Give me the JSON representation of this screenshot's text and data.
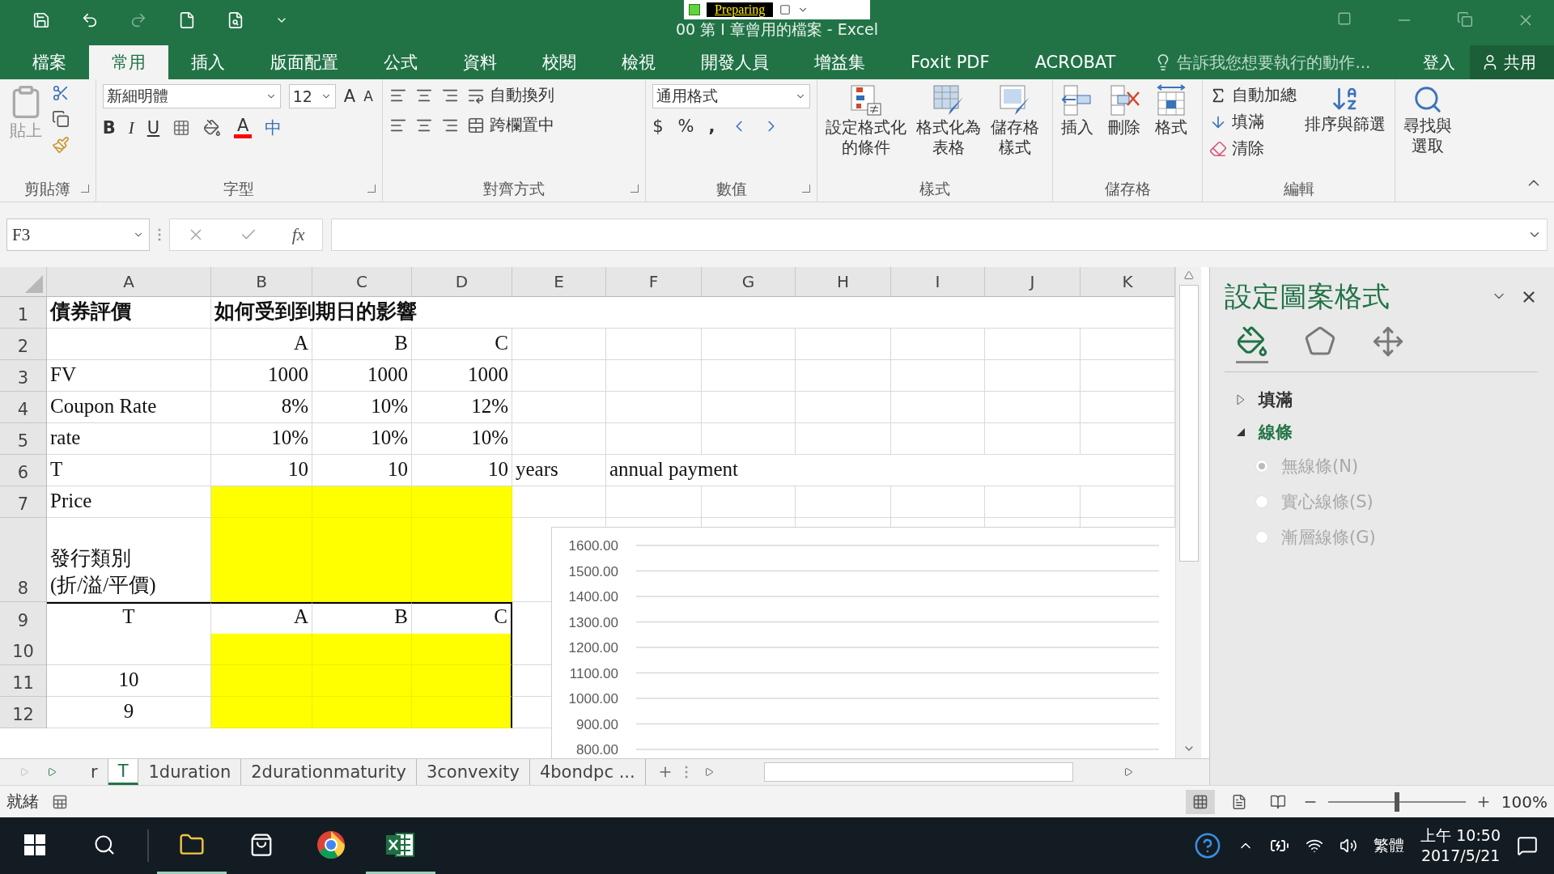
{
  "title_bar": {
    "title": "00 第 I 章曾用的檔案 - Excel",
    "recorder": {
      "status": "Preparing"
    }
  },
  "ribbon_tabs": [
    {
      "label": "檔案",
      "selected": false
    },
    {
      "label": "常用",
      "selected": true
    },
    {
      "label": "插入",
      "selected": false
    },
    {
      "label": "版面配置",
      "selected": false
    },
    {
      "label": "公式",
      "selected": false
    },
    {
      "label": "資料",
      "selected": false
    },
    {
      "label": "校閱",
      "selected": false
    },
    {
      "label": "檢視",
      "selected": false
    },
    {
      "label": "開發人員",
      "selected": false
    },
    {
      "label": "增益集",
      "selected": false
    },
    {
      "label": "Foxit PDF",
      "selected": false
    },
    {
      "label": "ACROBAT",
      "selected": false
    }
  ],
  "tell_me": {
    "placeholder": "告訴我您想要執行的動作..."
  },
  "account": {
    "sign_in": "登入",
    "share": "共用"
  },
  "ribbon": {
    "clipboard": {
      "label": "剪貼簿",
      "paste": "貼上"
    },
    "font": {
      "label": "字型",
      "name": "新細明體",
      "size": "12",
      "grow": "A",
      "shrink": "A",
      "bold": "B",
      "italic": "I",
      "underline": "U",
      "font_color": "A",
      "phonetic": "中"
    },
    "alignment": {
      "label": "對齊方式",
      "wrap": "自動換列",
      "merge": "跨欄置中"
    },
    "number": {
      "label": "數值",
      "format": "通用格式",
      "currency": "$",
      "percent": "%",
      "comma": ","
    },
    "styles": {
      "label": "樣式",
      "buttons": [
        {
          "kind": "conditional",
          "lines": [
            "設定格式化",
            "的條件"
          ]
        },
        {
          "kind": "table",
          "lines": [
            "格式化為",
            "表格"
          ]
        },
        {
          "kind": "cell_styles",
          "lines": [
            "儲存格",
            "樣式"
          ]
        }
      ]
    },
    "cells": {
      "label": "儲存格",
      "buttons": [
        {
          "kind": "insert",
          "label": "插入"
        },
        {
          "kind": "delete",
          "label": "刪除"
        },
        {
          "kind": "format",
          "label": "格式"
        }
      ]
    },
    "editing": {
      "label": "編輯",
      "autosum": "自動加總",
      "fill": "填滿",
      "clear": "清除",
      "sort": "排序與篩選",
      "find": [
        "尋找與",
        "選取"
      ]
    }
  },
  "formula_bar": {
    "name_box": "F3",
    "function_label": "fx"
  },
  "sheet": {
    "columns": [
      "A",
      "B",
      "C",
      "D",
      "E",
      "F",
      "G",
      "H",
      "I",
      "J",
      "K"
    ],
    "rows": [
      {
        "number": "1",
        "cells": [
          {
            "text": "債券評價",
            "kind": "text",
            "bold": true,
            "highlighted": false
          },
          {
            "text": "如何受到到期日的影響",
            "kind": "text",
            "bold": true,
            "highlighted": false
          }
        ]
      },
      {
        "number": "2",
        "cells": [
          {
            "highlighted": false
          },
          {
            "text": "A",
            "kind": "value",
            "highlighted": false
          },
          {
            "text": "B",
            "kind": "value",
            "highlighted": false
          },
          {
            "text": "C",
            "kind": "value",
            "highlighted": false
          }
        ]
      },
      {
        "number": "3",
        "cells": [
          {
            "text": "FV",
            "kind": "text",
            "highlighted": false
          },
          {
            "text": "1000",
            "kind": "value",
            "highlighted": false
          },
          {
            "text": "1000",
            "kind": "value",
            "highlighted": false
          },
          {
            "text": "1000",
            "kind": "value",
            "highlighted": false
          }
        ]
      },
      {
        "number": "4",
        "cells": [
          {
            "text": "Coupon Rate",
            "kind": "text",
            "highlighted": false
          },
          {
            "text": "8%",
            "kind": "value",
            "highlighted": false
          },
          {
            "text": "10%",
            "kind": "value",
            "highlighted": false
          },
          {
            "text": "12%",
            "kind": "value",
            "highlighted": false
          }
        ]
      },
      {
        "number": "5",
        "cells": [
          {
            "text": "rate",
            "kind": "text",
            "highlighted": false
          },
          {
            "text": "10%",
            "kind": "value",
            "highlighted": false
          },
          {
            "text": "10%",
            "kind": "value",
            "highlighted": false
          },
          {
            "text": "10%",
            "kind": "value",
            "highlighted": false
          }
        ]
      },
      {
        "number": "6",
        "cells": [
          {
            "text": "T",
            "kind": "text",
            "highlighted": false
          },
          {
            "text": "10",
            "kind": "value",
            "highlighted": false
          },
          {
            "text": "10",
            "kind": "value",
            "highlighted": false
          },
          {
            "text": "10",
            "kind": "value",
            "highlighted": false
          },
          {
            "text": "years",
            "kind": "text",
            "highlighted": false
          },
          {
            "text": "annual payment",
            "kind": "text",
            "highlighted": false
          }
        ]
      },
      {
        "number": "7",
        "cells": [
          {
            "text": "Price",
            "kind": "text",
            "highlighted": false
          },
          {
            "highlighted": true
          },
          {
            "highlighted": true
          },
          {
            "highlighted": true
          }
        ]
      },
      {
        "number": "8",
        "cells": [
          {
            "text": "發行類別\n(折/溢/平價)",
            "kind": "text",
            "highlighted": false
          },
          {
            "highlighted": true
          },
          {
            "highlighted": true
          },
          {
            "highlighted": true
          }
        ]
      },
      {
        "number": "9",
        "cells": [
          {
            "text": "T",
            "kind": "center",
            "highlighted": false,
            "thick_top": true,
            "thick_right": false
          },
          {
            "text": "A",
            "kind": "value",
            "highlighted": false,
            "thick_top": true,
            "thick_right": false
          },
          {
            "text": "B",
            "kind": "value",
            "highlighted": false,
            "thick_top": true,
            "thick_right": false
          },
          {
            "text": "C",
            "kind": "value",
            "highlighted": false,
            "thick_top": true,
            "thick_right": true
          }
        ]
      },
      {
        "number": "10",
        "cells": [
          {
            "highlighted": false
          },
          {
            "highlighted": true
          },
          {
            "highlighted": true
          },
          {
            "highlighted": true,
            "thick_top": false,
            "thick_right": true
          }
        ]
      },
      {
        "number": "11",
        "cells": [
          {
            "text": "10",
            "kind": "center",
            "highlighted": false
          },
          {
            "highlighted": true
          },
          {
            "highlighted": true
          },
          {
            "highlighted": true,
            "thick_top": false,
            "thick_right": true
          }
        ]
      },
      {
        "number": "12",
        "cells": [
          {
            "text": "9",
            "kind": "center",
            "highlighted": false
          },
          {
            "highlighted": true
          },
          {
            "highlighted": true
          },
          {
            "highlighted": true,
            "thick_top": false,
            "thick_right": true
          }
        ]
      }
    ],
    "chart": {
      "axis_labels": [
        "1600.00",
        "1500.00",
        "1400.00",
        "1300.00",
        "1200.00",
        "1100.00",
        "1000.00",
        "900.00",
        "800.00"
      ]
    }
  },
  "format_pane": {
    "title": "設定圖案格式",
    "icon_tabs": [
      {
        "kind": "fill_line",
        "selected": true
      },
      {
        "kind": "effects",
        "selected": false
      },
      {
        "kind": "size",
        "selected": false
      }
    ],
    "sections": [
      {
        "label": "填滿",
        "expanded": false
      },
      {
        "label": "線條",
        "expanded": true,
        "options": [
          {
            "label": "無線條(N)",
            "selected": true,
            "disabled": true
          },
          {
            "label": "實心線條(S)",
            "selected": false,
            "disabled": true
          },
          {
            "label": "漸層線條(G)",
            "selected": false,
            "disabled": true
          }
        ]
      }
    ]
  },
  "sheet_tabs": [
    {
      "label": "r",
      "selected": false
    },
    {
      "label": "T",
      "selected": true
    },
    {
      "label": "1duration",
      "selected": false
    },
    {
      "label": "2durationmaturity",
      "selected": false
    },
    {
      "label": "3convexity",
      "selected": false
    },
    {
      "label": "4bondpc ...",
      "selected": false
    }
  ],
  "status_bar": {
    "status": "就緒",
    "zoom": "100%",
    "zoom_slider": {
      "level": 0.5
    }
  },
  "taskbar": {
    "language": "繁體",
    "time": "上午 10:50",
    "date": "2017/5/21"
  }
}
